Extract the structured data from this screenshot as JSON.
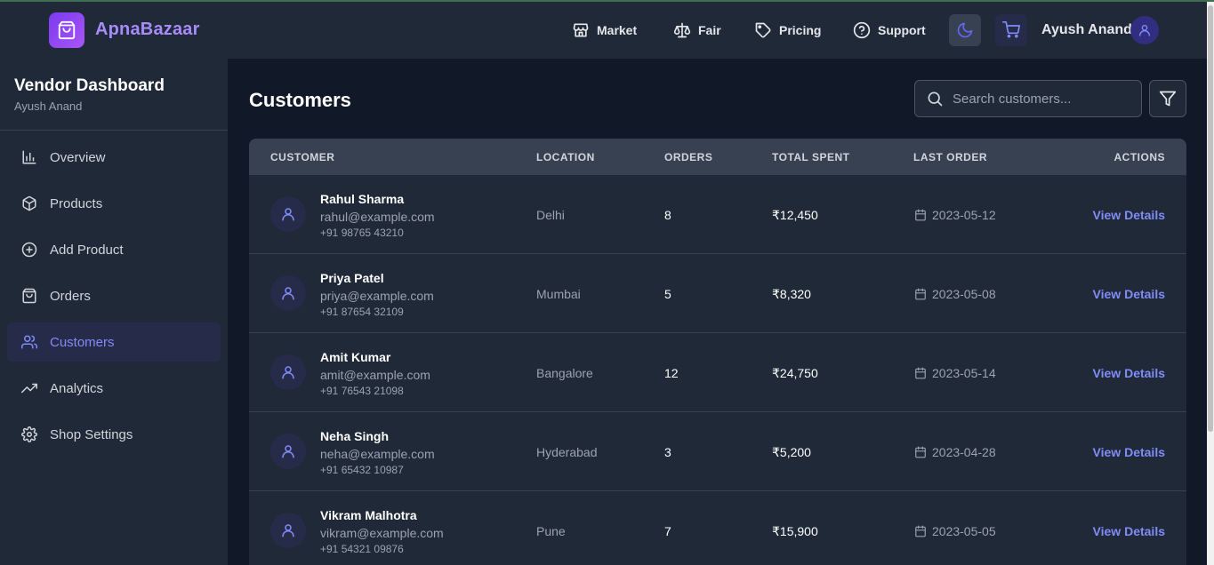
{
  "brand": {
    "name": "ApnaBazaar",
    "logo_icon": "shopping-bag-icon"
  },
  "nav": {
    "items": [
      {
        "label": "Market",
        "icon": "store-icon"
      },
      {
        "label": "Fair",
        "icon": "scale-icon"
      },
      {
        "label": "Pricing",
        "icon": "tag-icon"
      },
      {
        "label": "Support",
        "icon": "help-circle-icon"
      }
    ],
    "theme_icon": "moon-icon",
    "cart_icon": "cart-icon",
    "user_name": "Ayush Anand"
  },
  "sidebar": {
    "title": "Vendor Dashboard",
    "subtitle": "Ayush Anand",
    "items": [
      {
        "label": "Overview",
        "icon": "bar-chart-icon",
        "active": false
      },
      {
        "label": "Products",
        "icon": "box-icon",
        "active": false
      },
      {
        "label": "Add Product",
        "icon": "plus-circle-icon",
        "active": false
      },
      {
        "label": "Orders",
        "icon": "shopping-bag-icon",
        "active": false
      },
      {
        "label": "Customers",
        "icon": "users-icon",
        "active": true
      },
      {
        "label": "Analytics",
        "icon": "trending-up-icon",
        "active": false
      },
      {
        "label": "Shop Settings",
        "icon": "gear-icon",
        "active": false
      }
    ]
  },
  "main": {
    "title": "Customers",
    "search_placeholder": "Search customers...",
    "columns": {
      "customer": "CUSTOMER",
      "location": "LOCATION",
      "orders": "ORDERS",
      "total_spent": "TOTAL SPENT",
      "last_order": "LAST ORDER",
      "actions": "ACTIONS"
    },
    "rows": [
      {
        "name": "Rahul Sharma",
        "email": "rahul@example.com",
        "phone": "+91 98765 43210",
        "location": "Delhi",
        "orders": "8",
        "total_spent": "₹12,450",
        "last_order": "2023-05-12",
        "action": "View Details"
      },
      {
        "name": "Priya Patel",
        "email": "priya@example.com",
        "phone": "+91 87654 32109",
        "location": "Mumbai",
        "orders": "5",
        "total_spent": "₹8,320",
        "last_order": "2023-05-08",
        "action": "View Details"
      },
      {
        "name": "Amit Kumar",
        "email": "amit@example.com",
        "phone": "+91 76543 21098",
        "location": "Bangalore",
        "orders": "12",
        "total_spent": "₹24,750",
        "last_order": "2023-05-14",
        "action": "View Details"
      },
      {
        "name": "Neha Singh",
        "email": "neha@example.com",
        "phone": "+91 65432 10987",
        "location": "Hyderabad",
        "orders": "3",
        "total_spent": "₹5,200",
        "last_order": "2023-04-28",
        "action": "View Details"
      },
      {
        "name": "Vikram Malhotra",
        "email": "vikram@example.com",
        "phone": "+91 54321 09876",
        "location": "Pune",
        "orders": "7",
        "total_spent": "₹15,900",
        "last_order": "2023-05-05",
        "action": "View Details"
      }
    ]
  },
  "colors": {
    "accent": "#818cf8",
    "brand": "#a78bfa",
    "background": "#111827",
    "panel": "#1f2937"
  }
}
